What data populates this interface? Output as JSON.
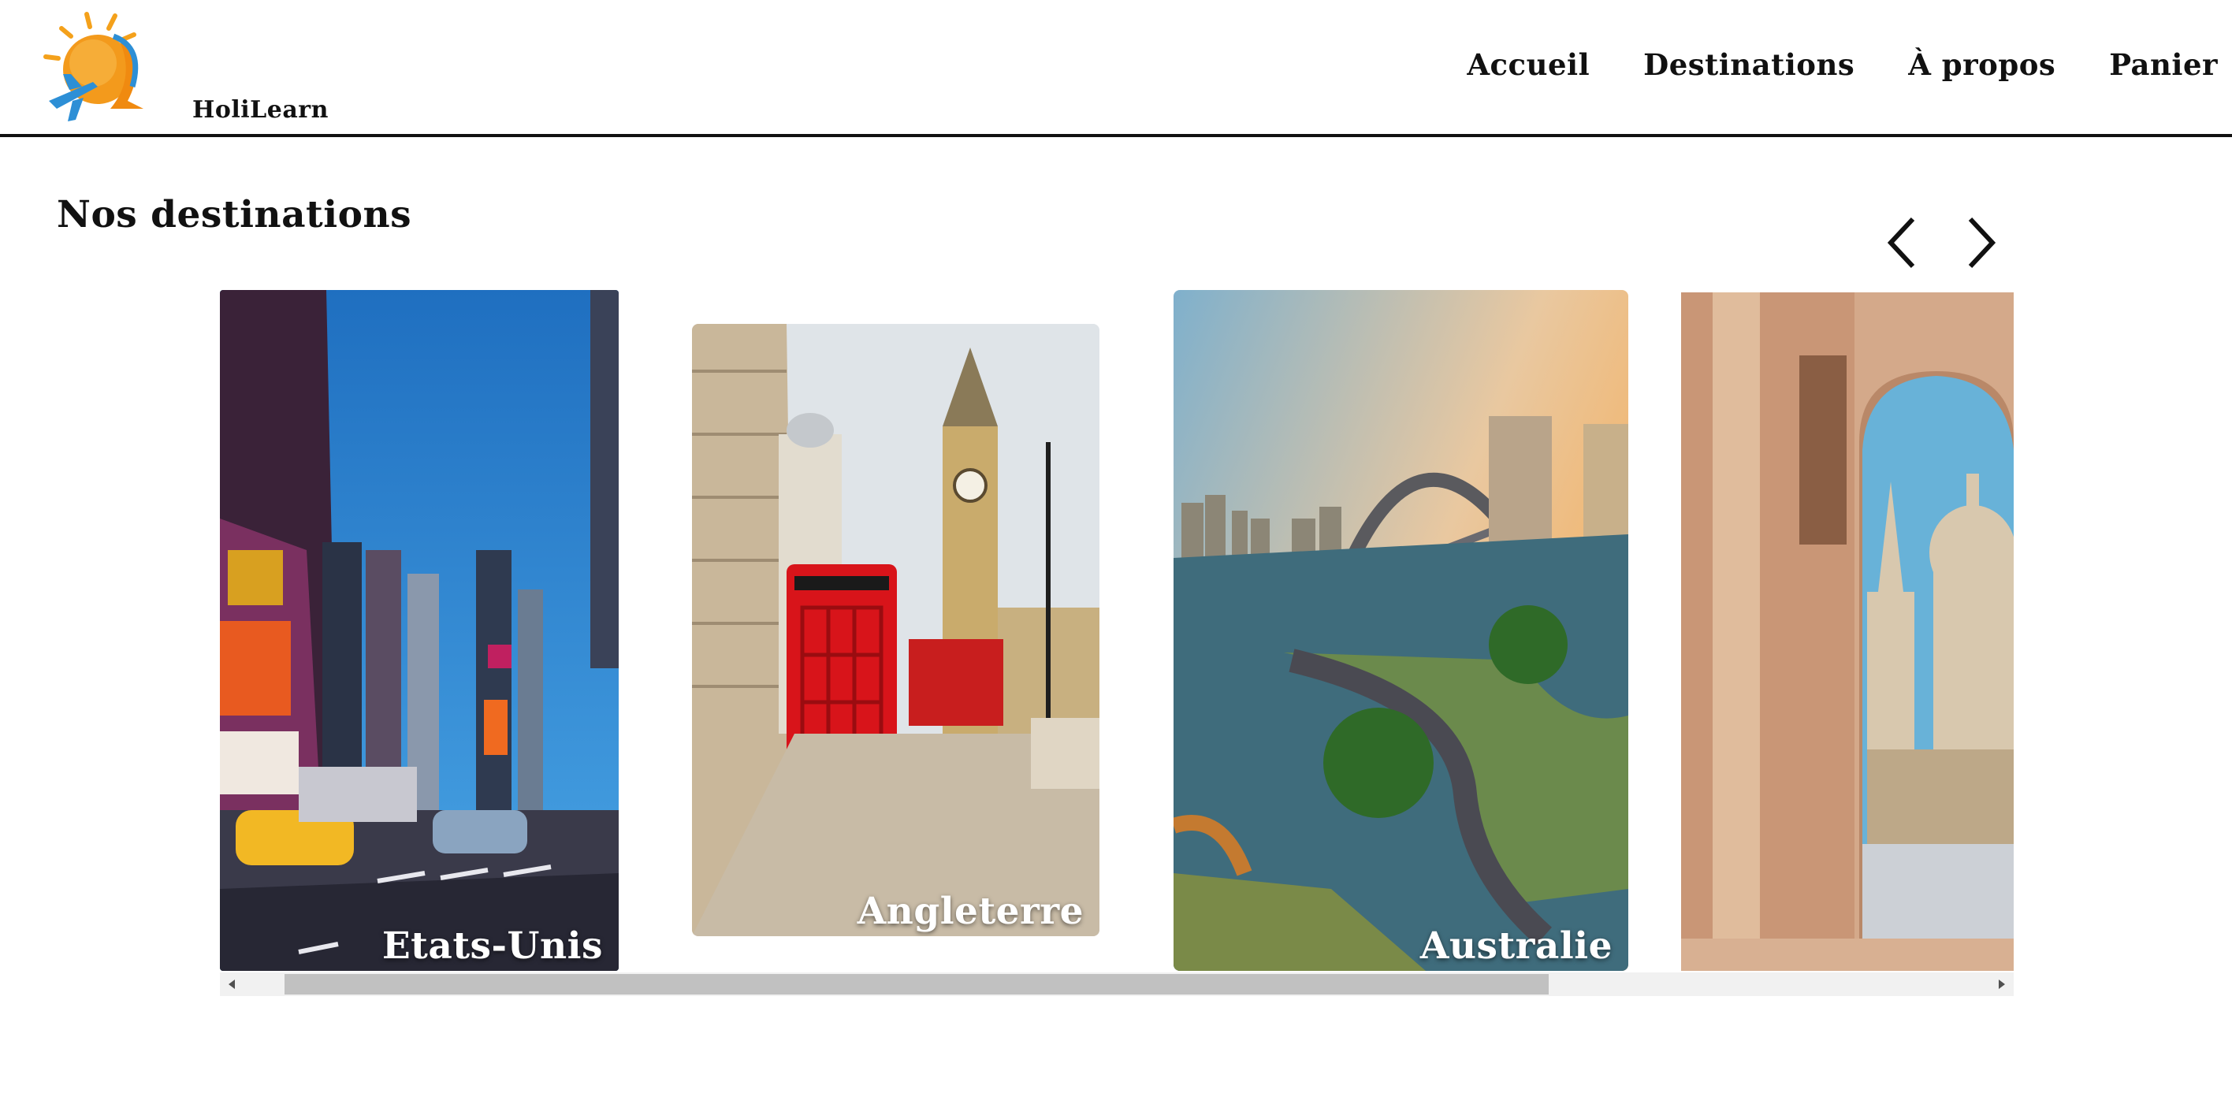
{
  "brand": {
    "name": "HoliLearn"
  },
  "nav": {
    "items": [
      "Accueil",
      "Destinations",
      "À propos",
      "Panier"
    ]
  },
  "main": {
    "title": "Nos destinations"
  },
  "carousel": {
    "cards": [
      {
        "label": "Etats-Unis"
      },
      {
        "label": "Angleterre"
      },
      {
        "label": "Australie"
      },
      {
        "label": ""
      }
    ]
  },
  "icons": {
    "logo": "sun-plane-logo",
    "prev": "chevron-left-icon",
    "next": "chevron-right-icon",
    "scroll_left": "triangle-left-icon",
    "scroll_right": "triangle-right-icon"
  },
  "colors": {
    "text": "#111111",
    "background": "#ffffff",
    "scroll_track": "#f1f1f1",
    "scroll_thumb": "#c1c1c1"
  }
}
